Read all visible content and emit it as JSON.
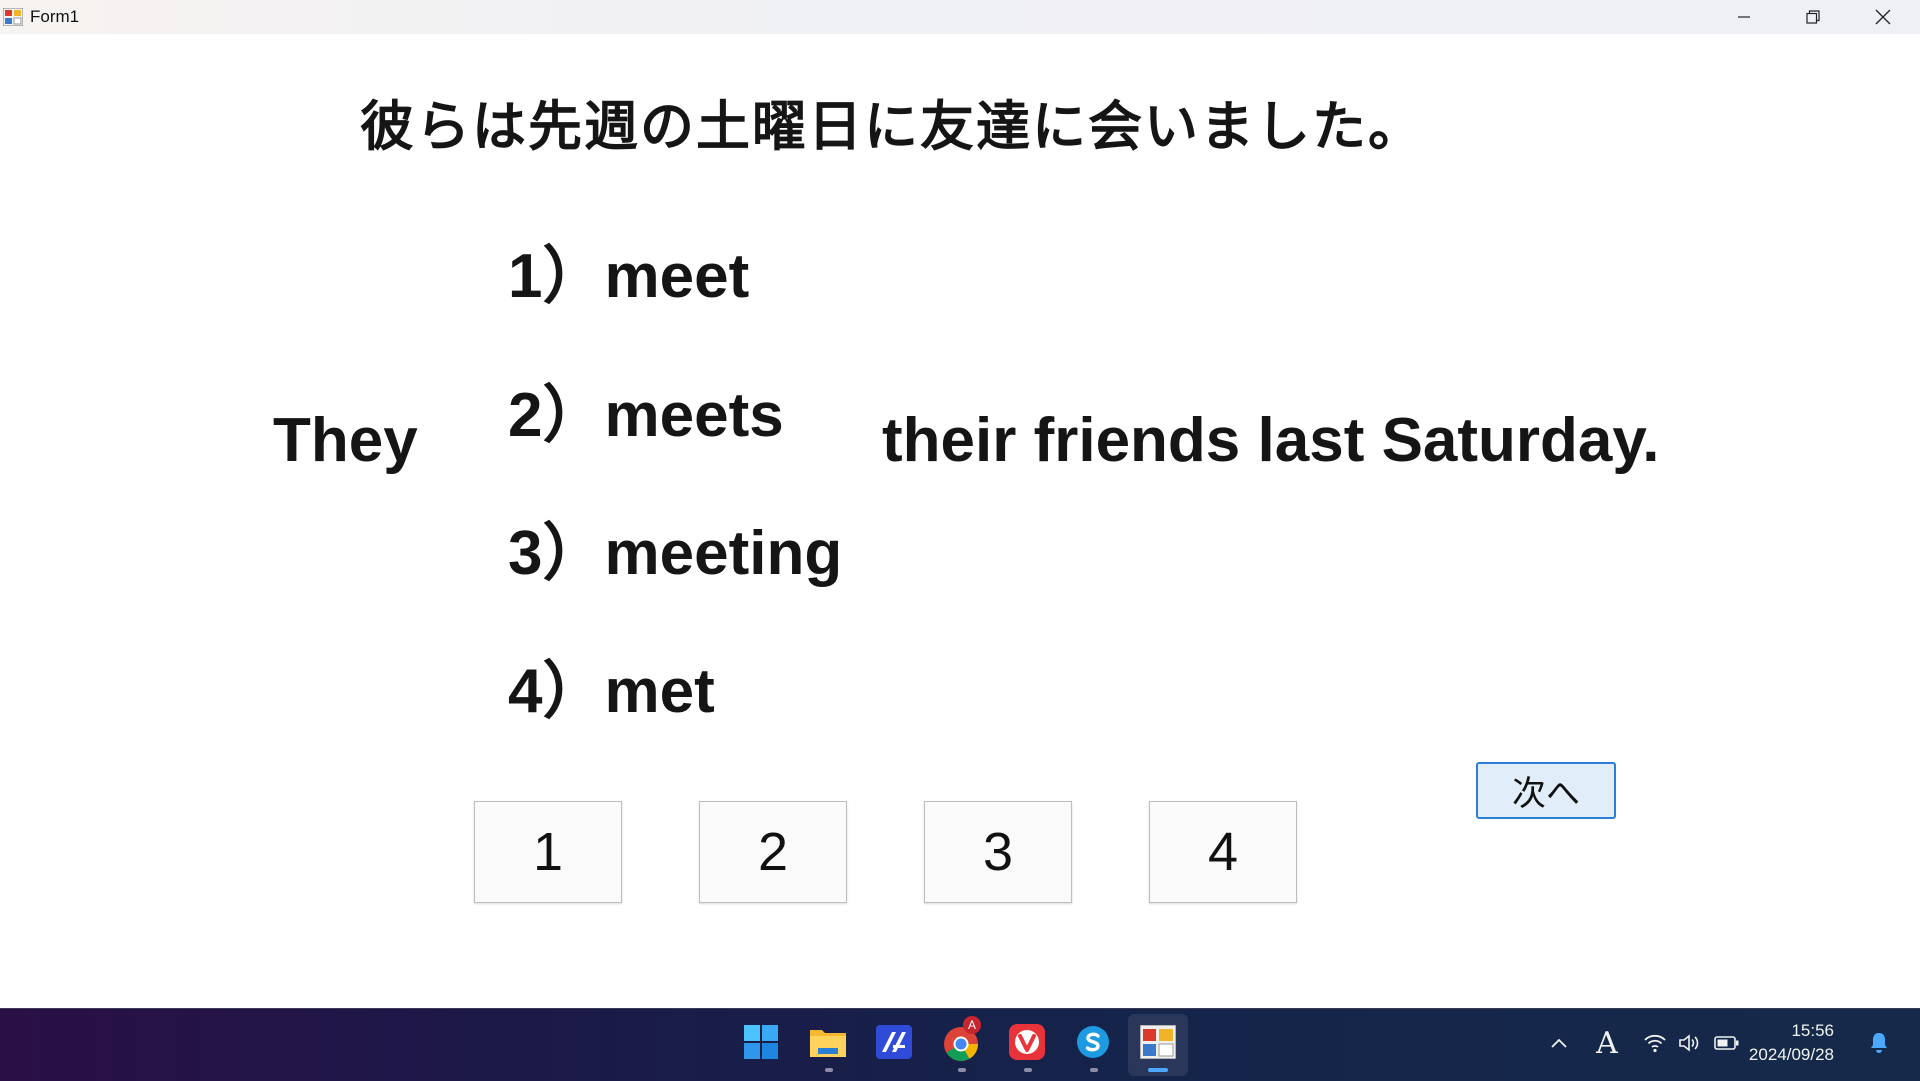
{
  "window": {
    "title": "Form1"
  },
  "question": {
    "japanese": "彼らは先週の土曜日に友達に会いました。",
    "subject": "They",
    "rest": "their friends last Saturday."
  },
  "options": [
    {
      "number": "1）",
      "word": "meet"
    },
    {
      "number": "2）",
      "word": "meets"
    },
    {
      "number": "3）",
      "word": "meeting"
    },
    {
      "number": "4）",
      "word": "met"
    }
  ],
  "answer_buttons": [
    "1",
    "2",
    "3",
    "4"
  ],
  "next_button": "次へ",
  "taskbar": {
    "apps": [
      "start-icon",
      "file-explorer-icon",
      "ai-app-icon",
      "chrome-icon",
      "vivaldi-icon",
      "skype-icon",
      "form-app-icon"
    ],
    "chrome_badge": "A",
    "ime_indicator": "A",
    "time": "15:56",
    "date": "2024/09/28"
  },
  "colors": {
    "next_border": "#2c7fd6",
    "next_bg": "#e1eefa",
    "accent": "#4ca8ff"
  }
}
